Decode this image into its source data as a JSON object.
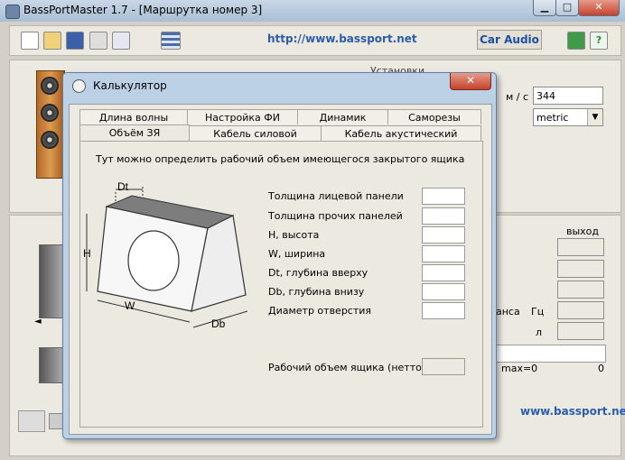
{
  "main": {
    "title": "BassPortMaster 1.7 - [Маршрутка номер 3]",
    "toolbar": {
      "url": "http://www.bassport.net",
      "car_audio_label": "Car Audio",
      "icons": [
        "new-file-icon",
        "open-folder-icon",
        "save-icon",
        "print-icon",
        "cut-icon",
        "calculator-icon",
        "notes-icon",
        "help-icon"
      ]
    },
    "top_label": "Установки",
    "sound_unit_label": "м / с",
    "sound_speed_value": "344",
    "units_value": "metric",
    "output_header": "выход",
    "resonance_label": "анса",
    "hz_label": "Гц",
    "l_label": "л",
    "max_label": "max=0",
    "zero_value": "0",
    "bottom_url": "www.bassport.net"
  },
  "dialog": {
    "title": "Калькулятор",
    "close_label": "✕",
    "tabs_row1": [
      "Длина волны",
      "Настройка ФИ",
      "Динамик",
      "Саморезы"
    ],
    "tabs_row2": [
      "Объём ЗЯ",
      "Кабель силовой",
      "Кабель акустический"
    ],
    "description": "Тут можно определить рабочий объем имеющегося закрытого ящика",
    "diagram": {
      "dt": "Dt",
      "h": "H",
      "w": "W",
      "db": "Db"
    },
    "fields": [
      {
        "label": "Толщина лицевой панели",
        "value": ""
      },
      {
        "label": "Толщина прочих панелей",
        "value": ""
      },
      {
        "label": "H, высота",
        "value": ""
      },
      {
        "label": "W, ширина",
        "value": ""
      },
      {
        "label": "Dt, глубина вверху",
        "value": ""
      },
      {
        "label": "Db, глубина внизу",
        "value": ""
      },
      {
        "label": "Диаметр отверстия",
        "value": ""
      }
    ],
    "result_label": "Рабочий объем ящика (нетто), л",
    "result_value": ""
  },
  "colors": {
    "title_bar": "#b9cbe0",
    "close_red": "#c4422d",
    "link_blue": "#2a5db0",
    "panel": "#ece9e1"
  }
}
